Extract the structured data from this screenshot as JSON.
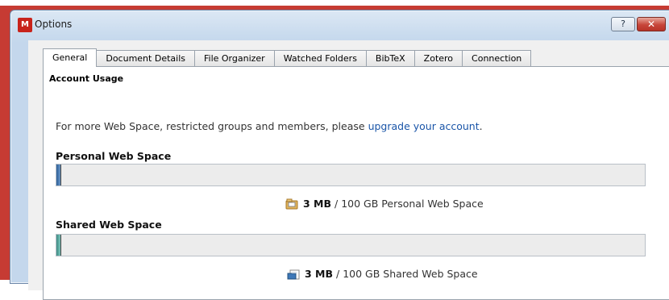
{
  "window": {
    "title": "Options",
    "app_icon_glyph": "M",
    "help_label": "?",
    "close_label": "✕",
    "accent": "#c63b33"
  },
  "tabs": [
    {
      "label": "General",
      "active": true
    },
    {
      "label": "Document Details"
    },
    {
      "label": "File Organizer"
    },
    {
      "label": "Watched Folders"
    },
    {
      "label": "BibTeX"
    },
    {
      "label": "Zotero"
    },
    {
      "label": "Connection"
    }
  ],
  "account": {
    "heading": "Account Usage",
    "info_text": "For more Web Space, restricted groups and members, please ",
    "upgrade_link": "upgrade your account",
    "info_suffix": ".",
    "personal": {
      "label": "Personal Web Space",
      "used": "3 MB",
      "rest": "/ 100 GB Personal Web Space",
      "fill_fraction": 0.005,
      "color": "#4a7fb8"
    },
    "shared": {
      "label": "Shared Web Space",
      "used": "3 MB",
      "rest": "/ 100 GB Shared Web Space",
      "fill_fraction": 0.005,
      "color": "#5fb0a6"
    }
  }
}
